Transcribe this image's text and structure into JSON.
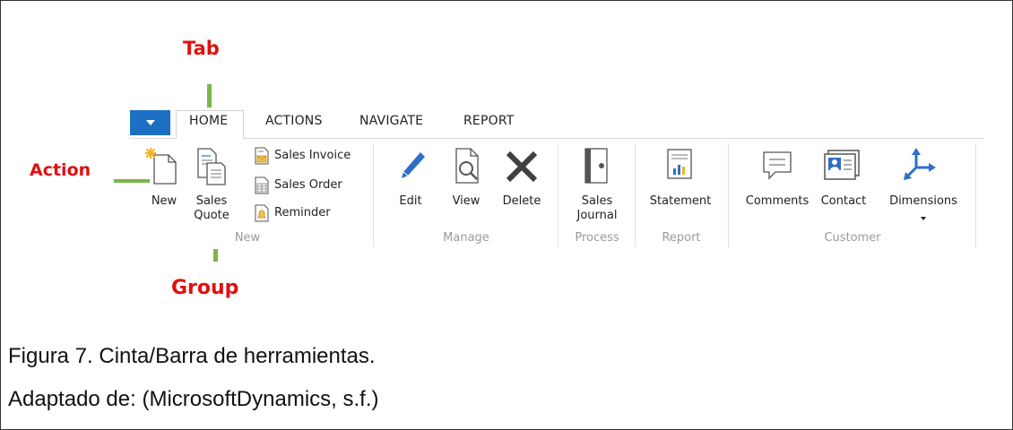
{
  "annotations": {
    "tab": "Tab",
    "action": "Action",
    "group": "Group"
  },
  "ribbon": {
    "tabs": [
      "HOME",
      "ACTIONS",
      "NAVIGATE",
      "REPORT"
    ],
    "active_tab": "HOME",
    "groups": {
      "new": {
        "label": "New",
        "new_button": "New",
        "sales_quote_line1": "Sales",
        "sales_quote_line2": "Quote",
        "small_items": [
          "Sales Invoice",
          "Sales Order",
          "Reminder"
        ]
      },
      "manage": {
        "label": "Manage",
        "buttons": [
          "Edit",
          "View",
          "Delete"
        ]
      },
      "process": {
        "label": "Process",
        "sales_journal_line1": "Sales",
        "sales_journal_line2": "Journal"
      },
      "report": {
        "label": "Report",
        "statement": "Statement"
      },
      "customer": {
        "label": "Customer",
        "buttons": [
          "Comments",
          "Contact",
          "Dimensions"
        ]
      }
    },
    "colors": {
      "app_button": "#1c6fc2",
      "icon_blue": "#2e6fc4",
      "annotation_red": "#e01010",
      "annotation_green": "#7ab648"
    }
  },
  "caption": {
    "line1": "Figura  7. Cinta/Barra de herramientas.",
    "line2": "Adaptado de: (MicrosoftDynamics, s.f.)"
  }
}
